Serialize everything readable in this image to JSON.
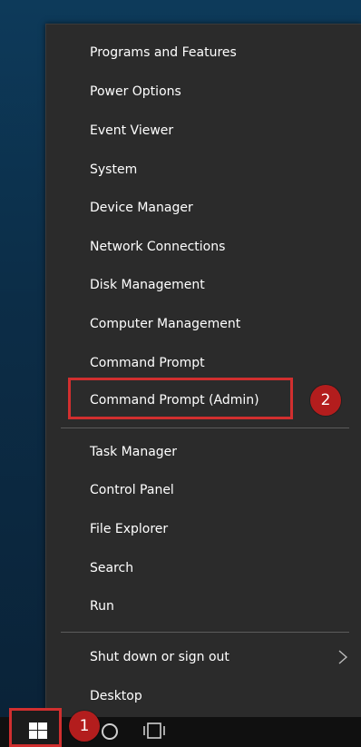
{
  "menu": {
    "items": [
      {
        "label": "Programs and Features"
      },
      {
        "label": "Power Options"
      },
      {
        "label": "Event Viewer"
      },
      {
        "label": "System"
      },
      {
        "label": "Device Manager"
      },
      {
        "label": "Network Connections"
      },
      {
        "label": "Disk Management"
      },
      {
        "label": "Computer Management"
      },
      {
        "label": "Command Prompt"
      },
      {
        "label": "Command Prompt (Admin)"
      },
      {
        "label": "Task Manager"
      },
      {
        "label": "Control Panel"
      },
      {
        "label": "File Explorer"
      },
      {
        "label": "Search"
      },
      {
        "label": "Run"
      },
      {
        "label": "Shut down or sign out"
      },
      {
        "label": "Desktop"
      }
    ]
  },
  "annotations": {
    "step1": "1",
    "step2": "2"
  },
  "taskbar": {
    "start_icon": "windows-logo-icon",
    "cortana_icon": "cortana-circle-icon",
    "taskview_icon": "task-view-icon"
  },
  "colors": {
    "menu_bg": "#2b2b2b",
    "highlight_border": "#d12f2f",
    "badge_bg": "#b31d1d",
    "text": "#ffffff"
  }
}
